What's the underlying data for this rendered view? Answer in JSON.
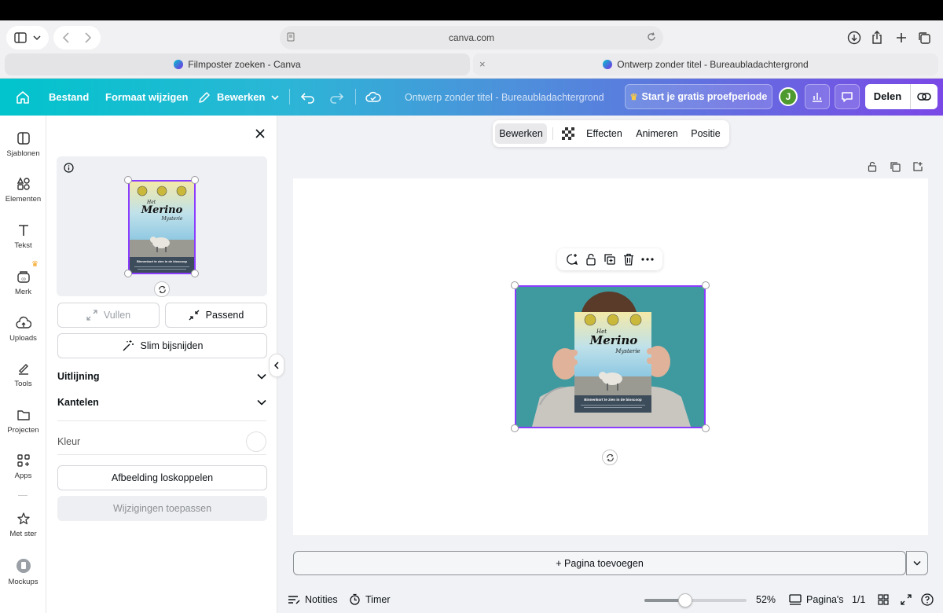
{
  "browser": {
    "url": "canva.com",
    "tabs": [
      {
        "title": "Filmposter zoeken - Canva"
      },
      {
        "title": "Ontwerp zonder titel - Bureaubladachtergrond"
      }
    ]
  },
  "header": {
    "menu": [
      "Bestand",
      "Formaat wijzigen",
      "Bewerken"
    ],
    "doc_title": "Ontwerp zonder titel - Bureaubladachtergrond",
    "trial_label": "Start je gratis proefperiode",
    "avatar_initial": "J",
    "share_label": "Delen"
  },
  "rail": {
    "items": [
      {
        "label": "Sjablonen",
        "icon": "templates-icon"
      },
      {
        "label": "Elementen",
        "icon": "elements-icon"
      },
      {
        "label": "Tekst",
        "icon": "text-icon"
      },
      {
        "label": "Merk",
        "icon": "brand-icon"
      },
      {
        "label": "Uploads",
        "icon": "upload-icon"
      },
      {
        "label": "Tools",
        "icon": "tools-icon"
      },
      {
        "label": "Projecten",
        "icon": "folder-icon"
      },
      {
        "label": "Apps",
        "icon": "apps-icon"
      },
      {
        "label": "Met ster",
        "icon": "star-icon"
      },
      {
        "label": "Mockups",
        "icon": "mockups-icon"
      }
    ]
  },
  "panel": {
    "fill_label": "Vullen",
    "fit_label": "Passend",
    "smart_crop_label": "Slim bijsnijden",
    "alignment_label": "Uitlijning",
    "tilt_label": "Kantelen",
    "color_label": "Kleur",
    "detach_label": "Afbeelding loskoppelen",
    "apply_label": "Wijzigingen toepassen"
  },
  "poster": {
    "title_top": "Het",
    "title_main": "Merino",
    "title_sub": "Mysterie",
    "tagline": "Binnenkort te zien in de bioscoop"
  },
  "context_bar": {
    "items": [
      "Bewerken",
      "Effecten",
      "Animeren",
      "Positie"
    ]
  },
  "canvas": {
    "add_page_label": "+ Pagina toevoegen"
  },
  "footer": {
    "notes_label": "Notities",
    "timer_label": "Timer",
    "zoom": "52%",
    "zoom_fraction": 0.4,
    "pages_label": "Pagina's",
    "page_count": "1/1"
  },
  "colors": {
    "accent": "#8b3dff",
    "header_start": "#01c4cc",
    "header_end": "#7a48e6",
    "photo_bg": "#3f9aa0"
  }
}
